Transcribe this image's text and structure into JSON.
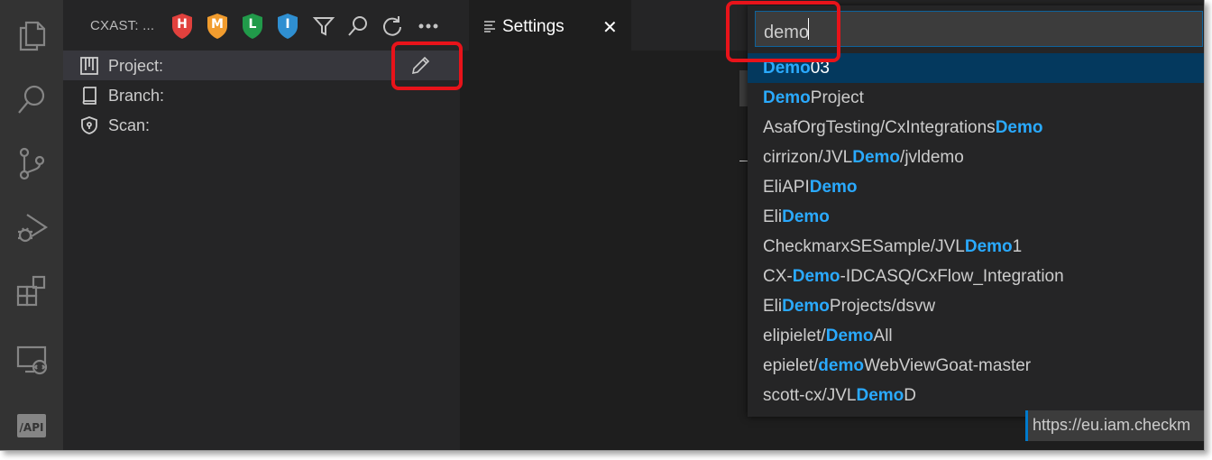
{
  "activity_bar": {
    "items": [
      {
        "name": "explorer-icon"
      },
      {
        "name": "search-icon"
      },
      {
        "name": "source-control-icon"
      },
      {
        "name": "run-debug-icon"
      },
      {
        "name": "extensions-icon"
      },
      {
        "name": "remote-explorer-icon"
      },
      {
        "name": "api-icon",
        "label": "/API"
      }
    ]
  },
  "sidebar": {
    "title": "CXAST: ...",
    "severity_badges": [
      {
        "letter": "H",
        "color": "#e1413d"
      },
      {
        "letter": "M",
        "color": "#f19c2e"
      },
      {
        "letter": "L",
        "color": "#219a4a"
      },
      {
        "letter": "I",
        "color": "#2f8fd1"
      }
    ],
    "tree": [
      {
        "label": "Project:",
        "icon": "project-board-icon"
      },
      {
        "label": "Branch:",
        "icon": "book-icon"
      },
      {
        "label": "Scan:",
        "icon": "shield-icon"
      }
    ]
  },
  "editor": {
    "tab": {
      "label": "Settings",
      "close": "✕"
    }
  },
  "quick_pick": {
    "input_value": "demo",
    "items": [
      {
        "pre": "",
        "match": "Demo",
        "post": "03"
      },
      {
        "pre": "",
        "match": "Demo",
        "post": "Project"
      },
      {
        "pre": "AsafOrgTesting/CxIntegrations",
        "match": "Demo",
        "post": ""
      },
      {
        "pre": "cirrizon/JVL",
        "match": "Demo",
        "post": "/jvldemo"
      },
      {
        "pre": "EliAPI",
        "match": "Demo",
        "post": ""
      },
      {
        "pre": "Eli",
        "match": "Demo",
        "post": ""
      },
      {
        "pre": "CheckmarxSESample/JVL",
        "match": "Demo",
        "post": "1"
      },
      {
        "pre": "CX-",
        "match": "Demo",
        "post": "-IDCASQ/CxFlow_Integration"
      },
      {
        "pre": "Eli",
        "match": "Demo",
        "post": "Projects/dsvw"
      },
      {
        "pre": "elipielet/",
        "match": "Demo",
        "post": "All"
      },
      {
        "pre": "epielet/",
        "match": "demo",
        "post": "WebViewGoat-master"
      },
      {
        "pre": "scott-cx/JVL",
        "match": "Demo",
        "post": "D"
      }
    ]
  },
  "background_setting": {
    "url": "https://eu.iam.checkm"
  },
  "colors": {
    "highlight": "#2aaaff",
    "annotation": "#e8131a",
    "active_item": "#04395e"
  }
}
